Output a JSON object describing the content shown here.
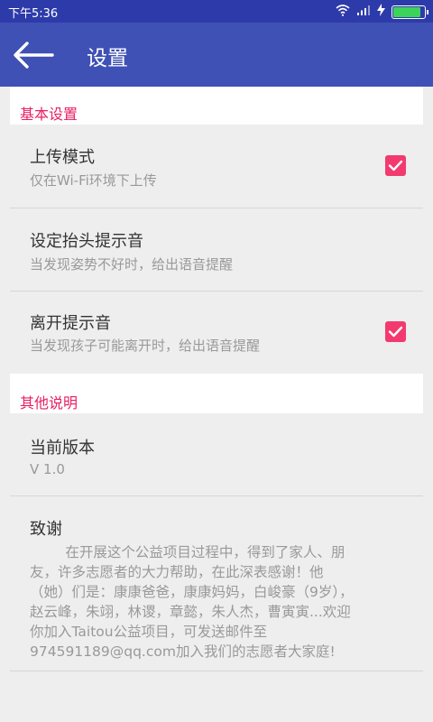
{
  "status_bar": {
    "time": "下午5:36",
    "icons": [
      "wifi-icon",
      "signal-icon",
      "charging-icon",
      "battery-icon"
    ],
    "battery_level": 0.9
  },
  "toolbar": {
    "title": "设置",
    "back_icon": "arrow-left-icon"
  },
  "sections": {
    "basic": {
      "header": "基本设置",
      "upload_mode": {
        "title": "上传模式",
        "summary": "仅在Wi-Fi环境下上传",
        "checked": true
      },
      "posture_sound": {
        "title": "设定抬头提示音",
        "summary": "当发现姿势不好时，给出语音提醒"
      },
      "leave_sound": {
        "title": "离开提示音",
        "summary": "当发现孩子可能离开时，给出语音提醒",
        "checked": true
      }
    },
    "other": {
      "header": "其他说明",
      "version": {
        "title": "当前版本",
        "summary": "V 1.0"
      },
      "thanks": {
        "title": "致谢",
        "lines": [
          "        在开展这个公益项目过程中，得到了家人、朋",
          "友，许多志愿者的大力帮助，在此深表感谢！他",
          "（她）们是：康康爸爸，康康妈妈，白峻豪（9岁），",
          "赵云峰，朱翊，林谡，章懿，朱人杰，曹寅寅...欢迎",
          "你加入Taitou公益项目，可发送邮件至",
          "974591189@qq.com加入我们的志愿者大家庭!"
        ]
      }
    }
  },
  "colors": {
    "status_bar": "#2d3baa",
    "toolbar": "#3f51b5",
    "accent": "#e91e63",
    "checkbox": "#f33a6f",
    "background": "#eeeeee"
  }
}
